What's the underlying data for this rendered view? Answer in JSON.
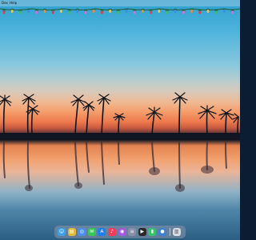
{
  "menubar": {
    "items": [
      "Dex",
      "Help"
    ]
  },
  "colors": {
    "sky_top": "#2d9fd0",
    "sunset": "#f59c6a",
    "water": "#2b5e83",
    "dock": "#8c96aa"
  },
  "dock": {
    "icons": [
      {
        "name": "finder-icon",
        "color": "#3aa0e8"
      },
      {
        "name": "folder-icon",
        "color": "#e0b93a"
      },
      {
        "name": "safari-icon",
        "color": "#4c8ff0"
      },
      {
        "name": "messages-icon",
        "color": "#36c759"
      },
      {
        "name": "app-store-icon",
        "color": "#1e7df3"
      },
      {
        "name": "music-icon",
        "color": "#f23c5b"
      },
      {
        "name": "podcasts-icon",
        "color": "#a35ae0"
      },
      {
        "name": "notes-icon",
        "color": "#8a8fa8"
      },
      {
        "name": "clapper-icon",
        "color": "#2a2a2a"
      },
      {
        "name": "chart-icon",
        "color": "#34c36a"
      },
      {
        "name": "droplet-icon",
        "color": "#3b7fd6"
      },
      {
        "name": "trash-icon",
        "color": "#d9dde4"
      }
    ]
  }
}
